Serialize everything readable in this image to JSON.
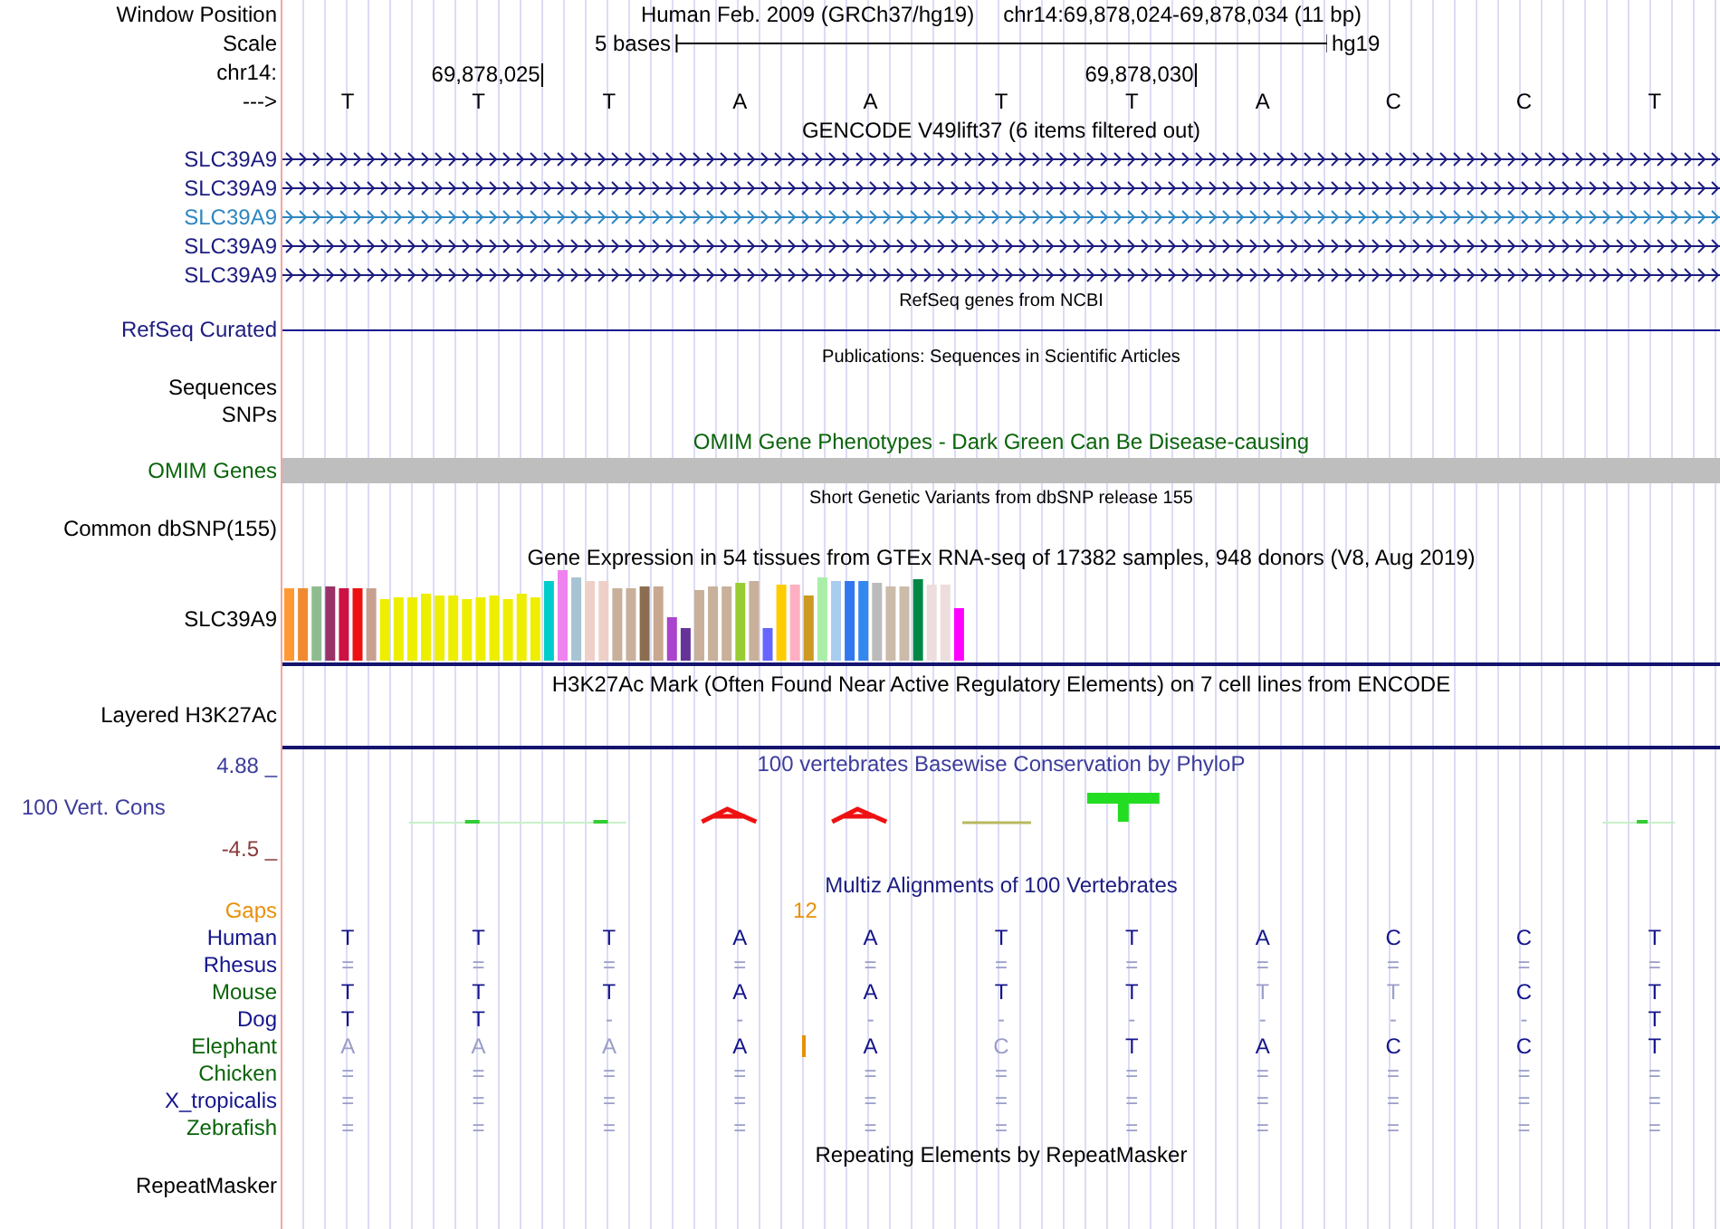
{
  "header": {
    "window_position_label": "Window Position",
    "assembly": "Human Feb. 2009 (GRCh37/hg19)",
    "position": "chr14:69,878,024-69,878,034 (11 bp)",
    "scale_label": "Scale",
    "scale_text": "5 bases",
    "scale_assembly": "hg19",
    "chrom_label": "chr14:",
    "strand_label": "--->"
  },
  "bases": [
    {
      "base": "T"
    },
    {
      "base": "T",
      "coordinate": "69,878,025"
    },
    {
      "base": "T"
    },
    {
      "base": "A"
    },
    {
      "base": "A"
    },
    {
      "base": "T"
    },
    {
      "base": "T",
      "coordinate": "69,878,030"
    },
    {
      "base": "A"
    },
    {
      "base": "C"
    },
    {
      "base": "C"
    },
    {
      "base": "T"
    }
  ],
  "gencode": {
    "title": "GENCODE V49lift37 (6 items filtered out)",
    "genes": [
      {
        "name": "SLC39A9",
        "color": "#1c1c80"
      },
      {
        "name": "SLC39A9",
        "color": "#1c1c80"
      },
      {
        "name": "SLC39A9",
        "color": "#2e86c1"
      },
      {
        "name": "SLC39A9",
        "color": "#1c1c80"
      },
      {
        "name": "SLC39A9",
        "color": "#1c1c80"
      }
    ]
  },
  "refseq": {
    "title": "RefSeq genes from NCBI",
    "label": "RefSeq Curated"
  },
  "publications": {
    "title": "Publications: Sequences in Scientific Articles",
    "labels": [
      "Sequences",
      "SNPs"
    ]
  },
  "omim": {
    "title": "OMIM Gene Phenotypes - Dark Green Can Be Disease-causing",
    "label": "OMIM Genes"
  },
  "dbsnp": {
    "title": "Short Genetic Variants from dbSNP release 155",
    "label": "Common dbSNP(155)"
  },
  "gtex": {
    "title": "Gene Expression in 54 tissues from GTEx RNA-seq of 17382 samples, 948 donors (V8, Aug 2019)",
    "label": "SLC39A9"
  },
  "h3k27ac": {
    "title": "H3K27Ac Mark (Often Found Near Active Regulatory Elements) on 7 cell lines from ENCODE",
    "label": "Layered H3K27Ac"
  },
  "phylop": {
    "title": "100 vertebrates Basewise Conservation by PhyloP",
    "label": "100 Vert. Cons",
    "max_label": "4.88 _",
    "min_label": "-4.5 _"
  },
  "multiz": {
    "title": "Multiz Alignments of 100 Vertebrates",
    "gaps_label": "Gaps",
    "gaps_count": "12",
    "species": [
      {
        "name": "Human",
        "color": "#14148c",
        "cells": [
          {
            "text": "T",
            "dim": false
          },
          {
            "text": "T",
            "dim": false
          },
          {
            "text": "T",
            "dim": false
          },
          {
            "text": "A",
            "dim": false
          },
          {
            "text": "A",
            "dim": false
          },
          {
            "text": "T",
            "dim": false
          },
          {
            "text": "T",
            "dim": false
          },
          {
            "text": "A",
            "dim": false
          },
          {
            "text": "C",
            "dim": false
          },
          {
            "text": "C",
            "dim": false
          },
          {
            "text": "T",
            "dim": false
          }
        ]
      },
      {
        "name": "Rhesus",
        "color": "#14148c",
        "cells": [
          {
            "text": "=",
            "dim": true
          },
          {
            "text": "=",
            "dim": true
          },
          {
            "text": "=",
            "dim": true
          },
          {
            "text": "=",
            "dim": true
          },
          {
            "text": "=",
            "dim": true
          },
          {
            "text": "=",
            "dim": true
          },
          {
            "text": "=",
            "dim": true
          },
          {
            "text": "=",
            "dim": true
          },
          {
            "text": "=",
            "dim": true
          },
          {
            "text": "=",
            "dim": true
          },
          {
            "text": "=",
            "dim": true
          }
        ]
      },
      {
        "name": "Mouse",
        "color": "#0a640a",
        "cells": [
          {
            "text": "T",
            "dim": false
          },
          {
            "text": "T",
            "dim": false
          },
          {
            "text": "T",
            "dim": false
          },
          {
            "text": "A",
            "dim": false
          },
          {
            "text": "A",
            "dim": false
          },
          {
            "text": "T",
            "dim": false
          },
          {
            "text": "T",
            "dim": false
          },
          {
            "text": "T",
            "dim": true
          },
          {
            "text": "T",
            "dim": true
          },
          {
            "text": "C",
            "dim": false
          },
          {
            "text": "T",
            "dim": false
          }
        ]
      },
      {
        "name": "Dog",
        "color": "#14148c",
        "cells": [
          {
            "text": "T",
            "dim": false
          },
          {
            "text": "T",
            "dim": false
          },
          {
            "text": "-",
            "dim": true
          },
          {
            "text": "-",
            "dim": true
          },
          {
            "text": "-",
            "dim": true
          },
          {
            "text": "-",
            "dim": true
          },
          {
            "text": "-",
            "dim": true
          },
          {
            "text": "-",
            "dim": true
          },
          {
            "text": "-",
            "dim": true
          },
          {
            "text": "-",
            "dim": true
          },
          {
            "text": "T",
            "dim": false
          }
        ]
      },
      {
        "name": "Elephant",
        "color": "#0a640a",
        "cells": [
          {
            "text": "A",
            "dim": true
          },
          {
            "text": "A",
            "dim": true
          },
          {
            "text": "A",
            "dim": true
          },
          {
            "text": "A",
            "dim": false,
            "insert_after": true
          },
          {
            "text": "A",
            "dim": false
          },
          {
            "text": "C",
            "dim": true
          },
          {
            "text": "T",
            "dim": false
          },
          {
            "text": "A",
            "dim": false
          },
          {
            "text": "C",
            "dim": false
          },
          {
            "text": "C",
            "dim": false
          },
          {
            "text": "T",
            "dim": false
          }
        ]
      },
      {
        "name": "Chicken",
        "color": "#0a640a",
        "cells": [
          {
            "text": "=",
            "dim": true
          },
          {
            "text": "=",
            "dim": true
          },
          {
            "text": "=",
            "dim": true
          },
          {
            "text": "=",
            "dim": true
          },
          {
            "text": "=",
            "dim": true
          },
          {
            "text": "=",
            "dim": true
          },
          {
            "text": "=",
            "dim": true
          },
          {
            "text": "=",
            "dim": true
          },
          {
            "text": "=",
            "dim": true
          },
          {
            "text": "=",
            "dim": true
          },
          {
            "text": "=",
            "dim": true
          }
        ]
      },
      {
        "name": "X_tropicalis",
        "color": "#14148c",
        "cells": [
          {
            "text": "=",
            "dim": true
          },
          {
            "text": "=",
            "dim": true
          },
          {
            "text": "=",
            "dim": true
          },
          {
            "text": "=",
            "dim": true
          },
          {
            "text": "=",
            "dim": true
          },
          {
            "text": "=",
            "dim": true
          },
          {
            "text": "=",
            "dim": true
          },
          {
            "text": "=",
            "dim": true
          },
          {
            "text": "=",
            "dim": true
          },
          {
            "text": "=",
            "dim": true
          },
          {
            "text": "=",
            "dim": true
          }
        ]
      },
      {
        "name": "Zebrafish",
        "color": "#0a640a",
        "cells": [
          {
            "text": "=",
            "dim": true
          },
          {
            "text": "=",
            "dim": true
          },
          {
            "text": "=",
            "dim": true
          },
          {
            "text": "=",
            "dim": true
          },
          {
            "text": "=",
            "dim": true
          },
          {
            "text": "=",
            "dim": true
          },
          {
            "text": "=",
            "dim": true
          },
          {
            "text": "=",
            "dim": true
          },
          {
            "text": "=",
            "dim": true
          },
          {
            "text": "=",
            "dim": true
          },
          {
            "text": "=",
            "dim": true
          }
        ]
      }
    ]
  },
  "repeatmasker": {
    "title": "Repeating Elements by RepeatMasker",
    "label": "RepeatMasker"
  }
}
